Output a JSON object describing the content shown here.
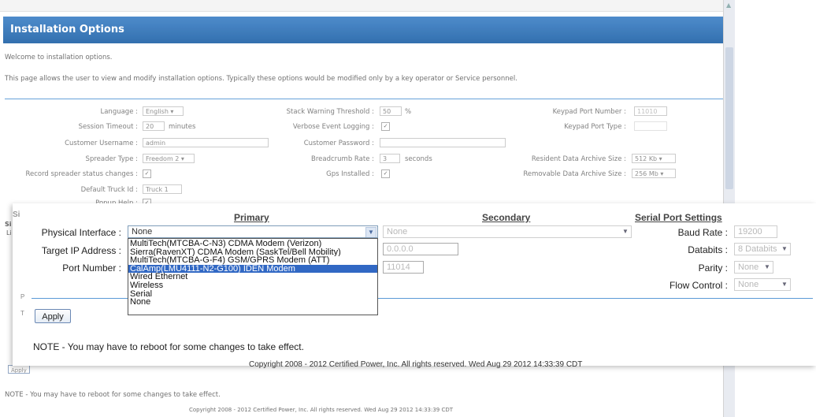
{
  "background": {
    "header": "Installation Options",
    "welcome": "Welcome to installation options.",
    "description": "This page allows the user to view and modify installation options. Typically these options would be modified only by a key operator or Service personnel.",
    "fields": {
      "language_label": "Language :",
      "language_value": "English",
      "session_timeout_label": "Session Timeout :",
      "session_timeout_value": "20",
      "session_timeout_unit": "minutes",
      "customer_username_label": "Customer Username :",
      "customer_username_value": "admin",
      "spreader_type_label": "Spreader Type :",
      "spreader_type_value": "Freedom 2",
      "record_status_label": "Record spreader status changes :",
      "default_truck_label": "Default Truck Id :",
      "default_truck_value": "Truck 1",
      "popup_help_label": "Popup Help :",
      "stack_warning_label": "Stack Warning Threshold :",
      "stack_warning_value": "50",
      "stack_warning_unit": "%",
      "verbose_logging_label": "Verbose Event Logging :",
      "customer_password_label": "Customer Password :",
      "breadcrumb_rate_label": "Breadcrumb Rate :",
      "breadcrumb_rate_value": "3",
      "breadcrumb_rate_unit": "seconds",
      "gps_installed_label": "Gps Installed :",
      "keypad_port_number_label": "Keypad Port Number :",
      "keypad_port_number_value": "11010",
      "keypad_port_type_label": "Keypad Port Type :",
      "resident_archive_label": "Resident Data Archive Size :",
      "resident_archive_value": "512 Kb",
      "removable_archive_label": "Removable Data Archive Size :",
      "removable_archive_value": "256 Mb"
    },
    "apply_label": "Apply",
    "note": "NOTE - You may have to reboot for some changes to take effect.",
    "copyright": "Copyright 2008 - 2012 Certified Power, Inc. All rights reserved. Wed Aug 29 2012 14:33:39 CDT",
    "side_fragment_1": "Si",
    "side_fragment_2": "Li"
  },
  "panel": {
    "primary_header": "Primary",
    "secondary_header": "Secondary",
    "serial_header": "Serial Port Settings",
    "physical_interface_label": "Physical Interface :",
    "physical_interface_value": "None",
    "target_ip_label": "Target IP Address :",
    "port_number_label": "Port Number :",
    "secondary_interface_value": "None",
    "secondary_ip_value": "0.0.0.0",
    "secondary_port_value": "11014",
    "baud_rate_label": "Baud Rate :",
    "baud_rate_value": "19200",
    "databits_label": "Databits :",
    "databits_value": "8 Databits",
    "parity_label": "Parity :",
    "parity_value": "None",
    "flow_control_label": "Flow Control :",
    "flow_control_value": "None",
    "dropdown_options": [
      "MultiTech(MTCBA-C-N3) CDMA Modem (Verizon)",
      "Sierra(RavenXT) CDMA Modem (SaskTel/Bell Mobility)",
      "MultiTech(MTCBA-G-F4) GSM/GPRS Modem (ATT)",
      "CalAmp(LMU4111-N2-G100) IDEN Modem",
      "Wired Ethernet",
      "Wireless",
      "Serial",
      "None"
    ],
    "dropdown_selected_index": 3,
    "apply_label": "Apply",
    "note": "NOTE - You may have to reboot for some changes to take effect.",
    "copyright": "Copyright 2008 - 2012 Certified Power, Inc. All rights reserved. Wed Aug 29 2012 14:33:39 CDT",
    "side_fragment_p": "P",
    "side_fragment_t": "T"
  },
  "colors": {
    "header_blue": "#2a6db4",
    "selection_blue": "#3168c4",
    "separator_blue": "#5a9ad6"
  }
}
